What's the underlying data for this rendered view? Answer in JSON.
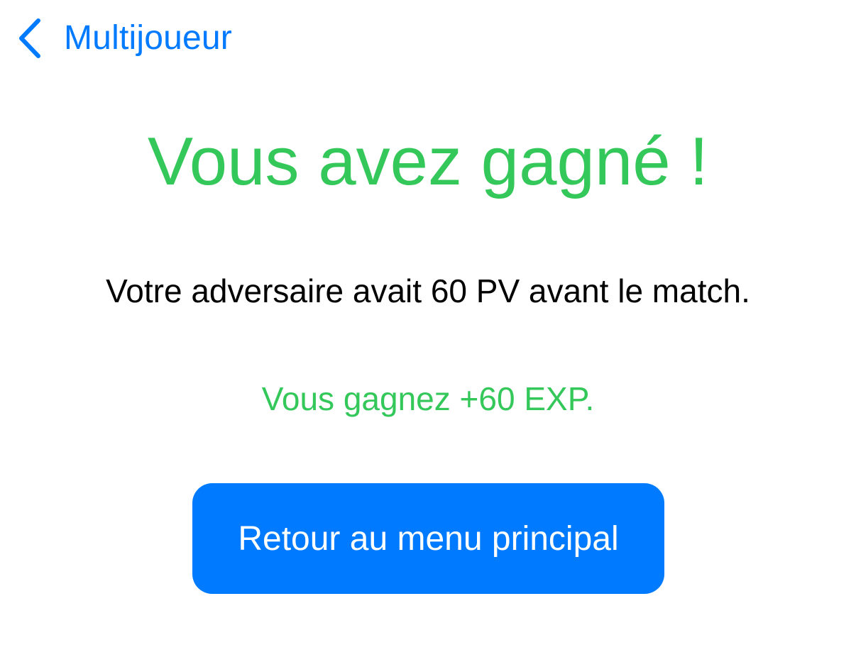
{
  "nav": {
    "back_label": "Multijoueur",
    "back_icon": "chevron-left-icon"
  },
  "result": {
    "title": "Vous avez gagné !",
    "opponent_info": "Votre adversaire avait 60 PV avant le match.",
    "exp_gain": "Vous gagnez +60 EXP."
  },
  "actions": {
    "main_menu_label": "Retour au menu principal"
  },
  "colors": {
    "accent_blue": "#007aff",
    "success_green": "#34c759",
    "text_black": "#000000",
    "background": "#ffffff"
  }
}
